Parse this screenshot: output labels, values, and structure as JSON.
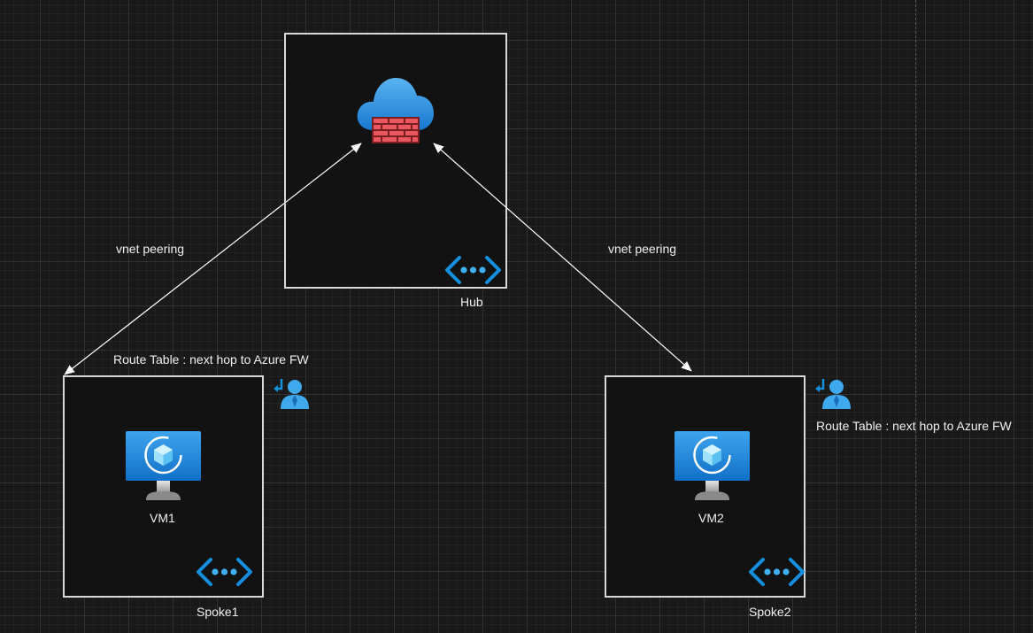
{
  "diagram": {
    "hub": {
      "label": "Hub",
      "firewall_icon": "azure-firewall-icon",
      "vnet_icon": "virtual-network-icon"
    },
    "spoke1": {
      "label": "Spoke1",
      "vm_label": "VM1",
      "vm_icon": "virtual-machine-icon",
      "vnet_icon": "virtual-network-icon"
    },
    "spoke2": {
      "label": "Spoke2",
      "vm_label": "VM2",
      "vm_icon": "virtual-machine-icon",
      "vnet_icon": "virtual-network-icon"
    },
    "edges": [
      {
        "from": "spoke1",
        "to": "hub",
        "label": "vnet peering",
        "bidirectional": true
      },
      {
        "from": "hub",
        "to": "spoke2",
        "label": "vnet peering",
        "bidirectional": true
      }
    ],
    "route_tables": [
      {
        "attached_to": "spoke1",
        "label": "Route Table : next hop to Azure FW",
        "icon": "route-table-icon"
      },
      {
        "attached_to": "spoke2",
        "label": "Route Table : next hop to Azure FW",
        "icon": "route-table-icon"
      }
    ]
  },
  "colors": {
    "canvas": "#191919",
    "box_border": "#d8d8d8",
    "azure_blue": "#1490df",
    "firewall_red": "#e8585e",
    "text": "#f0f0f0"
  }
}
